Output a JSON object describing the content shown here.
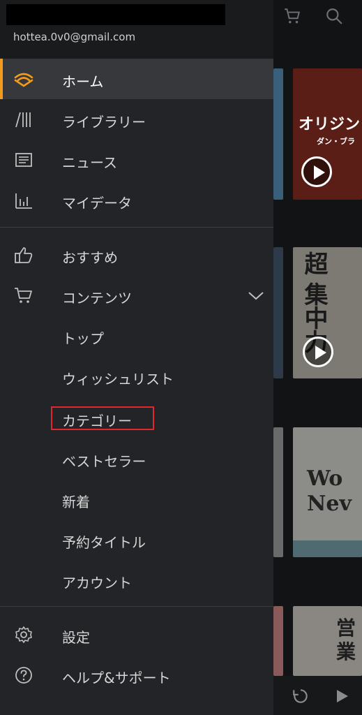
{
  "account": {
    "email": "hottea.0v0@gmail.com"
  },
  "menu": {
    "primary": [
      {
        "label": "ホーム",
        "icon": "audible-home-icon",
        "active": true
      },
      {
        "label": "ライブラリー",
        "icon": "library-icon"
      },
      {
        "label": "ニュース",
        "icon": "news-icon"
      },
      {
        "label": "マイデータ",
        "icon": "stats-icon"
      }
    ],
    "secondary": [
      {
        "label": "おすすめ",
        "icon": "thumbs-up-icon"
      },
      {
        "label": "コンテンツ",
        "icon": "cart-icon",
        "expanded": true
      }
    ],
    "content_sub": [
      {
        "label": "トップ"
      },
      {
        "label": "ウィッシュリスト"
      },
      {
        "label": "カテゴリー",
        "highlighted": true
      },
      {
        "label": "ベストセラー"
      },
      {
        "label": "新着"
      },
      {
        "label": "予約タイトル"
      },
      {
        "label": "アカウント"
      }
    ],
    "footer": [
      {
        "label": "設定",
        "icon": "gear-icon"
      },
      {
        "label": "ヘルプ&サポート",
        "icon": "help-icon"
      }
    ]
  },
  "background": {
    "covers": [
      {
        "text1": "オリジン",
        "text2": "ダン・ブラ"
      },
      {
        "text1": "超",
        "text2": "集中力"
      },
      {
        "text1": "Wo",
        "text2": "Nev"
      },
      {
        "text1": "営",
        "text2": "業"
      }
    ]
  },
  "colors": {
    "accent": "#f39b1a",
    "highlight_box": "#e2262b",
    "drawer_bg": "#232427"
  }
}
